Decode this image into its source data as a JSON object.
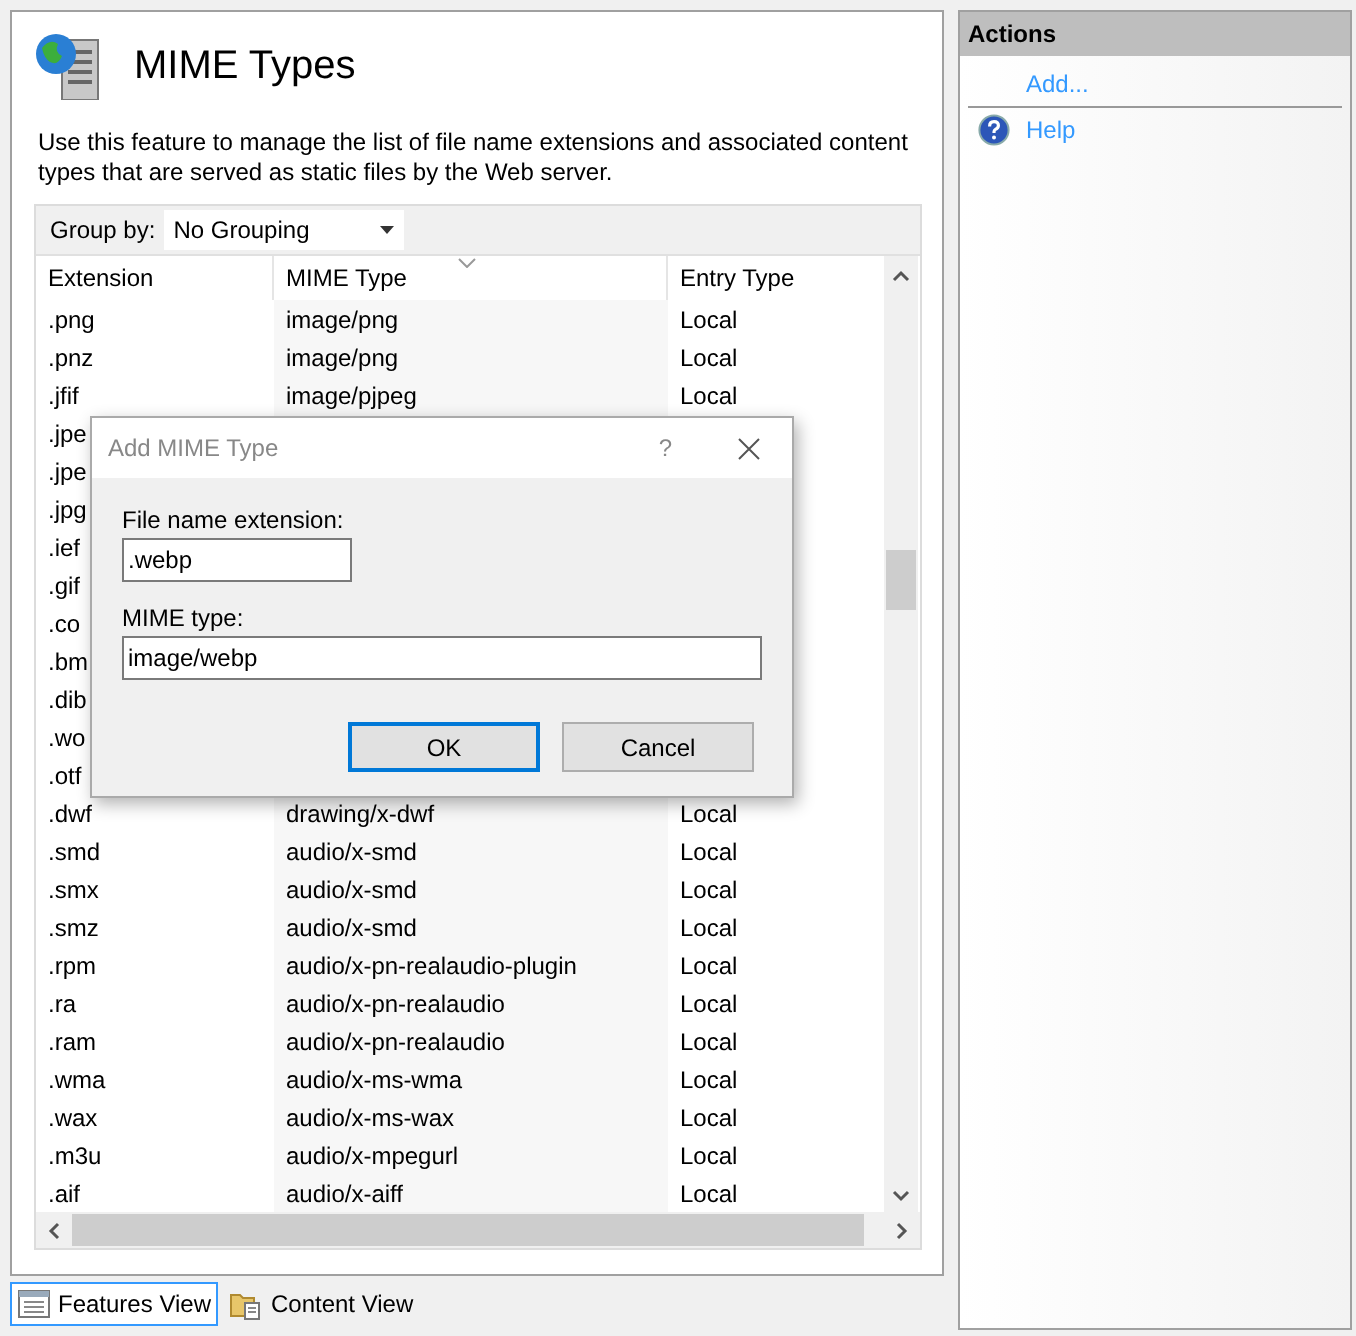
{
  "page": {
    "title": "MIME Types",
    "description": "Use this feature to manage the list of file name extensions and associated content types that are served as static files by the Web server."
  },
  "toolbar": {
    "group_by_label": "Group by:",
    "group_by_value": "No Grouping"
  },
  "table": {
    "columns": [
      "Extension",
      "MIME Type",
      "Entry Type"
    ],
    "rows": [
      {
        "extension": ".png",
        "mime_type": "image/png",
        "entry_type": "Local"
      },
      {
        "extension": ".pnz",
        "mime_type": "image/png",
        "entry_type": "Local"
      },
      {
        "extension": ".jfif",
        "mime_type": "image/pjpeg",
        "entry_type": "Local"
      },
      {
        "extension": ".jpe"
      },
      {
        "extension": ".jpe"
      },
      {
        "extension": ".jpg"
      },
      {
        "extension": ".ief"
      },
      {
        "extension": ".gif"
      },
      {
        "extension": ".co"
      },
      {
        "extension": ".bm"
      },
      {
        "extension": ".dib"
      },
      {
        "extension": ".wo"
      },
      {
        "extension": ".otf"
      },
      {
        "extension": ".dwf",
        "mime_type": "drawing/x-dwf",
        "entry_type": "Local"
      },
      {
        "extension": ".smd",
        "mime_type": "audio/x-smd",
        "entry_type": "Local"
      },
      {
        "extension": ".smx",
        "mime_type": "audio/x-smd",
        "entry_type": "Local"
      },
      {
        "extension": ".smz",
        "mime_type": "audio/x-smd",
        "entry_type": "Local"
      },
      {
        "extension": ".rpm",
        "mime_type": "audio/x-pn-realaudio-plugin",
        "entry_type": "Local"
      },
      {
        "extension": ".ra",
        "mime_type": "audio/x-pn-realaudio",
        "entry_type": "Local"
      },
      {
        "extension": ".ram",
        "mime_type": "audio/x-pn-realaudio",
        "entry_type": "Local"
      },
      {
        "extension": ".wma",
        "mime_type": "audio/x-ms-wma",
        "entry_type": "Local"
      },
      {
        "extension": ".wax",
        "mime_type": "audio/x-ms-wax",
        "entry_type": "Local"
      },
      {
        "extension": ".m3u",
        "mime_type": "audio/x-mpegurl",
        "entry_type": "Local"
      },
      {
        "extension": ".aif",
        "mime_type": "audio/x-aiff",
        "entry_type": "Local"
      }
    ]
  },
  "dialog": {
    "title": "Add MIME Type",
    "help": "?",
    "fields": [
      {
        "label": "File name extension:",
        "value": ".webp",
        "kind": "short"
      },
      {
        "label": "MIME type:",
        "value": "image/webp",
        "kind": "wide"
      }
    ],
    "buttons": [
      {
        "label": "OK",
        "default": true
      },
      {
        "label": "Cancel",
        "default": false
      }
    ]
  },
  "actions": {
    "title": "Actions",
    "items": [
      {
        "label": "Add...",
        "kind": "link"
      },
      {
        "label": "Help",
        "kind": "help"
      }
    ]
  },
  "views": [
    {
      "label": "Features View",
      "selected": true,
      "kind": "features"
    },
    {
      "label": "Content View",
      "selected": false,
      "kind": "content"
    }
  ]
}
